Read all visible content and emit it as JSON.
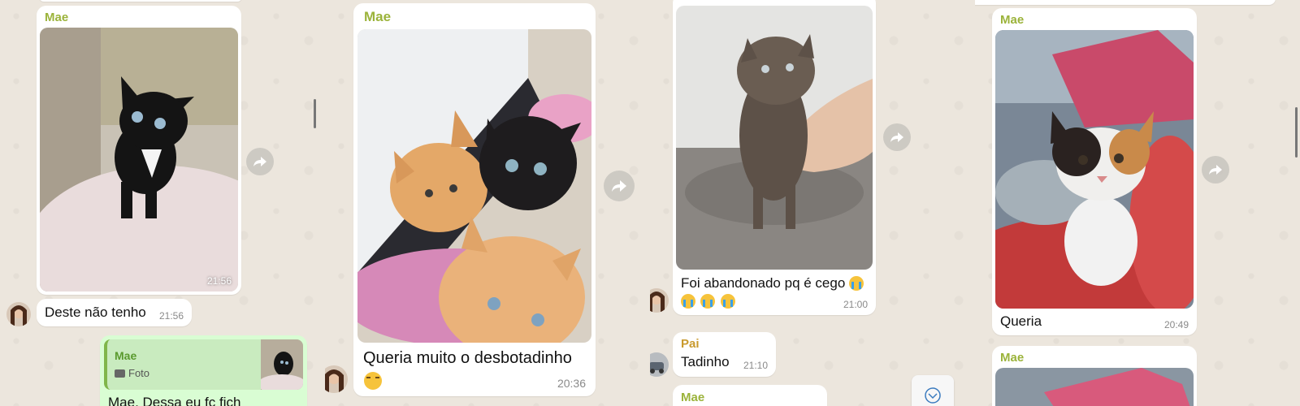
{
  "panel1": {
    "photo_msg": {
      "sender": "Mae",
      "time": "21:56"
    },
    "text_msg": {
      "text": "Deste não tenho",
      "time": "21:56"
    },
    "reply_msg": {
      "quoted_sender": "Mae",
      "quoted_type": "Foto",
      "text_partial": "Mae, Dessa eu fç fich"
    }
  },
  "panel2": {
    "photo_msg": {
      "sender": "Mae",
      "caption": "Queria muito o desbotadinho",
      "time": "20:36"
    }
  },
  "panel3": {
    "photo_msg": {
      "caption": "Foi abandonado pq é cego",
      "time": "21:00"
    },
    "pai_msg": {
      "sender": "Pai",
      "text": "Tadinho",
      "time": "21:10"
    },
    "next_msg": {
      "sender": "Mae"
    }
  },
  "panel4": {
    "photo_msg": {
      "sender": "Mae",
      "caption": "Queria",
      "time": "20:49"
    },
    "next_msg": {
      "sender": "Mae"
    }
  },
  "colors": {
    "mae_sender": "#9bb33a",
    "pai_sender": "#c99a2e",
    "bubble_out": "#d9fdd3",
    "chat_bg": "#ece6dd"
  },
  "icons": [
    "forward-icon",
    "camera-icon",
    "scroll-down-chevron-icon"
  ]
}
